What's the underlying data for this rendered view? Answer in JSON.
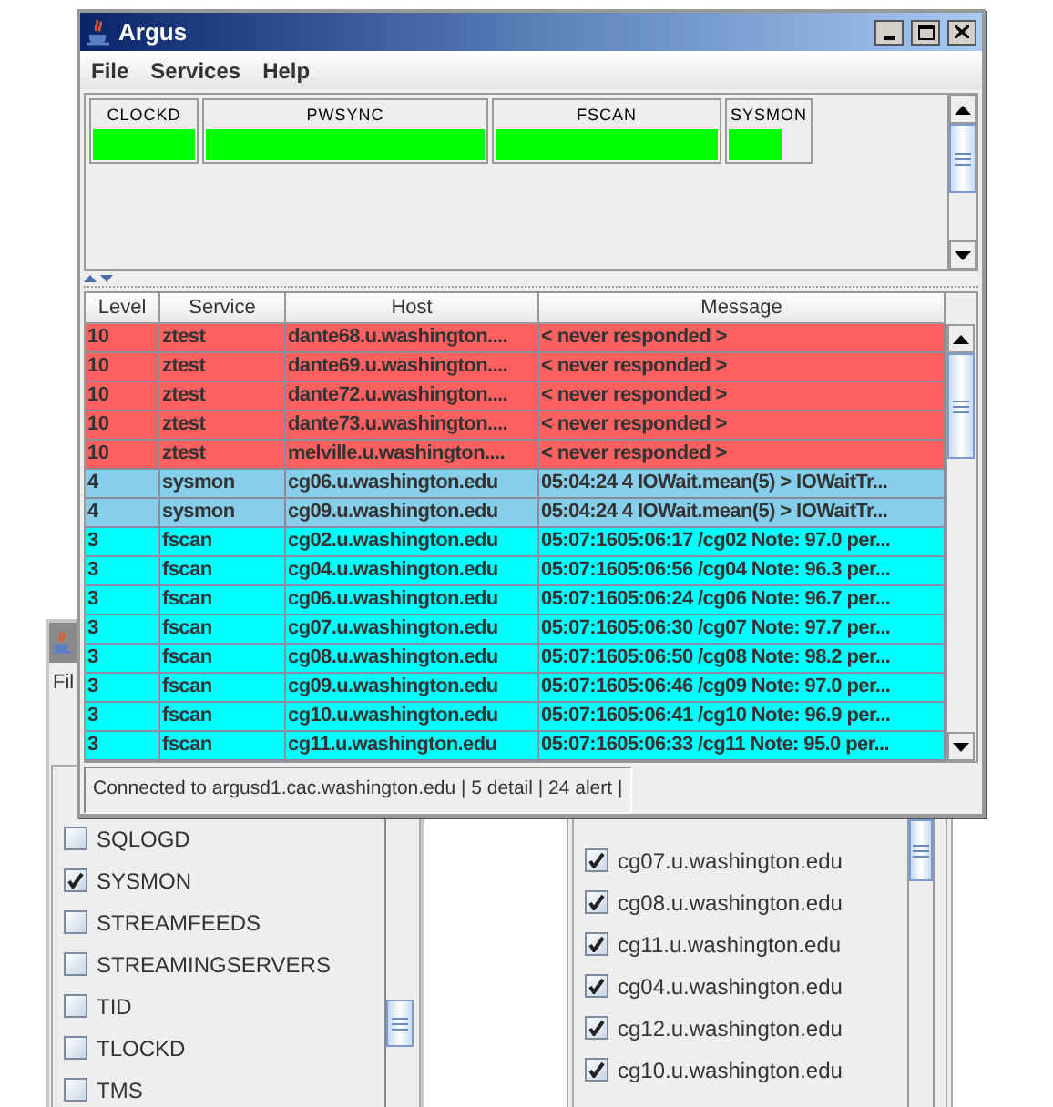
{
  "service_list_window": {
    "menu": [
      "Fil"
    ],
    "items": [
      {
        "label": "SQLOGD",
        "checked": false
      },
      {
        "label": "SYSMON",
        "checked": true
      },
      {
        "label": "STREAMFEEDS",
        "checked": false
      },
      {
        "label": "STREAMINGSERVERS",
        "checked": false
      },
      {
        "label": "TID",
        "checked": false
      },
      {
        "label": "TLOCKD",
        "checked": false
      },
      {
        "label": "TMS",
        "checked": false
      }
    ]
  },
  "host_list_window": {
    "items": [
      {
        "label": "cg07.u.washington.edu",
        "checked": true
      },
      {
        "label": "cg08.u.washington.edu",
        "checked": true
      },
      {
        "label": "cg11.u.washington.edu",
        "checked": true
      },
      {
        "label": "cg04.u.washington.edu",
        "checked": true
      },
      {
        "label": "cg12.u.washington.edu",
        "checked": true
      },
      {
        "label": "cg10.u.washington.edu",
        "checked": true
      }
    ]
  },
  "main_window": {
    "title": "Argus",
    "menu": [
      "File",
      "Services",
      "Help"
    ],
    "services": [
      {
        "name": "CLOCKD",
        "level": 1
      },
      {
        "name": "PWSYNC",
        "level": 1
      },
      {
        "name": "FSCAN",
        "level": 1
      },
      {
        "name": "SYSMON",
        "level": 0.66
      }
    ],
    "table": {
      "columns": [
        "Level",
        "Service",
        "Host",
        "Message"
      ],
      "rows": [
        {
          "color": "#ff6060",
          "cells": [
            "10",
            "ztest",
            "dante68.u.washington....",
            "< never responded >"
          ]
        },
        {
          "color": "#ff6060",
          "cells": [
            "10",
            "ztest",
            "dante69.u.washington....",
            "< never responded >"
          ]
        },
        {
          "color": "#ff6060",
          "cells": [
            "10",
            "ztest",
            "dante72.u.washington....",
            "< never responded >"
          ]
        },
        {
          "color": "#ff6060",
          "cells": [
            "10",
            "ztest",
            "dante73.u.washington....",
            "< never responded >"
          ]
        },
        {
          "color": "#ff6060",
          "cells": [
            "10",
            "ztest",
            "melville.u.washington....",
            "< never responded >"
          ]
        },
        {
          "color": "#87ceeb",
          "cells": [
            "4",
            "sysmon",
            "cg06.u.washington.edu",
            "05:04:24 4 IOWait.mean(5) > IOWaitTr..."
          ]
        },
        {
          "color": "#87ceeb",
          "cells": [
            "4",
            "sysmon",
            "cg09.u.washington.edu",
            "05:04:24 4 IOWait.mean(5) > IOWaitTr..."
          ]
        },
        {
          "color": "#00ffff",
          "cells": [
            "3",
            "fscan",
            "cg02.u.washington.edu",
            "05:07:1605:06:17 /cg02 Note: 97.0 per..."
          ]
        },
        {
          "color": "#00ffff",
          "cells": [
            "3",
            "fscan",
            "cg04.u.washington.edu",
            "05:07:1605:06:56 /cg04 Note: 96.3 per..."
          ]
        },
        {
          "color": "#00ffff",
          "cells": [
            "3",
            "fscan",
            "cg06.u.washington.edu",
            "05:07:1605:06:24 /cg06 Note: 96.7 per..."
          ]
        },
        {
          "color": "#00ffff",
          "cells": [
            "3",
            "fscan",
            "cg07.u.washington.edu",
            "05:07:1605:06:30 /cg07 Note: 97.7 per..."
          ]
        },
        {
          "color": "#00ffff",
          "cells": [
            "3",
            "fscan",
            "cg08.u.washington.edu",
            "05:07:1605:06:50 /cg08 Note: 98.2 per..."
          ]
        },
        {
          "color": "#00ffff",
          "cells": [
            "3",
            "fscan",
            "cg09.u.washington.edu",
            "05:07:1605:06:46 /cg09 Note: 97.0 per..."
          ]
        },
        {
          "color": "#00ffff",
          "cells": [
            "3",
            "fscan",
            "cg10.u.washington.edu",
            "05:07:1605:06:41 /cg10 Note: 96.9 per..."
          ]
        },
        {
          "color": "#00ffff",
          "cells": [
            "3",
            "fscan",
            "cg11.u.washington.edu",
            "05:07:1605:06:33 /cg11 Note: 95.0 per..."
          ]
        }
      ]
    },
    "status_bar": "Connected to argusd1.cac.washington.edu | 5 detail | 24 alert |"
  }
}
